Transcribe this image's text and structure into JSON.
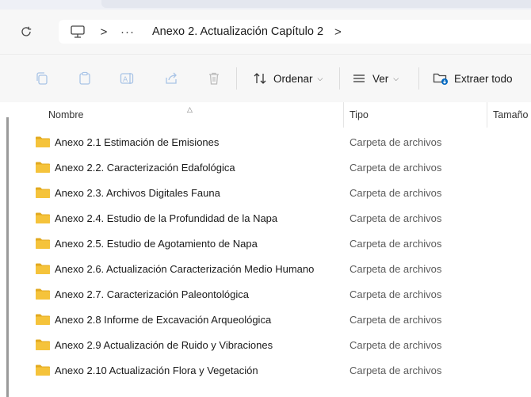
{
  "address_bar": {
    "breadcrumb": "Anexo 2. Actualización Capítulo 2",
    "overflow": "···",
    "separator": ">"
  },
  "toolbar": {
    "sort_label": "Ordenar",
    "view_label": "Ver",
    "extract_label": "Extraer todo"
  },
  "columns": {
    "name": "Nombre",
    "type": "Tipo",
    "size": "Tamaño"
  },
  "files": [
    {
      "name": "Anexo 2.1 Estimación de Emisiones",
      "type": "Carpeta de archivos"
    },
    {
      "name": "Anexo 2.2. Caracterización Edafológica",
      "type": "Carpeta de archivos"
    },
    {
      "name": "Anexo 2.3. Archivos Digitales Fauna",
      "type": "Carpeta de archivos"
    },
    {
      "name": "Anexo 2.4. Estudio de la Profundidad de la Napa",
      "type": "Carpeta de archivos"
    },
    {
      "name": "Anexo 2.5. Estudio de Agotamiento de Napa",
      "type": "Carpeta de archivos"
    },
    {
      "name": "Anexo 2.6. Actualización Caracterización Medio Humano",
      "type": "Carpeta de archivos"
    },
    {
      "name": "Anexo 2.7. Caracterización Paleontológica",
      "type": "Carpeta de archivos"
    },
    {
      "name": "Anexo 2.8 Informe de Excavación Arqueológica",
      "type": "Carpeta de archivos"
    },
    {
      "name": "Anexo 2.9 Actualización de Ruido y Vibraciones",
      "type": "Carpeta de archivos"
    },
    {
      "name": "Anexo 2.10 Actualización Flora y Vegetación",
      "type": "Carpeta de archivos"
    }
  ],
  "colors": {
    "folder": "#f5c33b",
    "folder_dark": "#e2a91f",
    "accent": "#0067c0",
    "disabled_icon": "#a9c4e6"
  }
}
